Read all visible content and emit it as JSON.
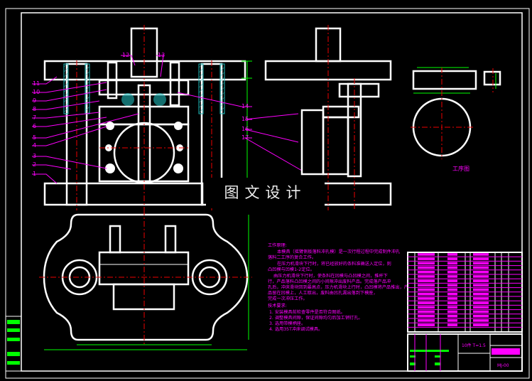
{
  "part_labels": [
    "1",
    "2",
    "3",
    "4",
    "5",
    "6",
    "7",
    "8",
    "9",
    "10",
    "11",
    "12",
    "13",
    "14",
    "15",
    "16",
    "17"
  ],
  "process_drawing_label": "工序图",
  "notes": {
    "title": "工作原理:",
    "lines": [
      "本模具（摇臂侧板落料冲孔模）是一次行程过程中完成制件冲孔",
      "落料二工序的复合工作。",
      "在压力机滑块下行时，将已经放好的条料准确送入定位，则",
      "凸凹模与凹模1-2定位。",
      "由压力机滑块下行时，使条料在凹模与凸凹模之间，推杆下",
      "行，产品落料凸凹模之间的小间隙冲出废料产品。完成落产品冲",
      "孔后，冲床滑块回到最高点，压力机滑块上行时，凸凹模将产品推出，产",
      "品留在凹模上，人工取出，废料由凹孔漏出落到下模座，",
      "完成一次冲压工作。"
    ],
    "tech_title": "技术要求:",
    "tech": [
      "1.  安装模具前检查零件是否符合图纸。",
      "2.  调整模具间隙，保证间隙均匀后加工销钉孔。",
      "3.  选用带模柄座。",
      "4.  选用35T冲床调试模具。"
    ]
  },
  "title_block": {
    "spec": "10件 T=1.5",
    "drawing_no": "MJ-00"
  },
  "watermark": "图文设计"
}
